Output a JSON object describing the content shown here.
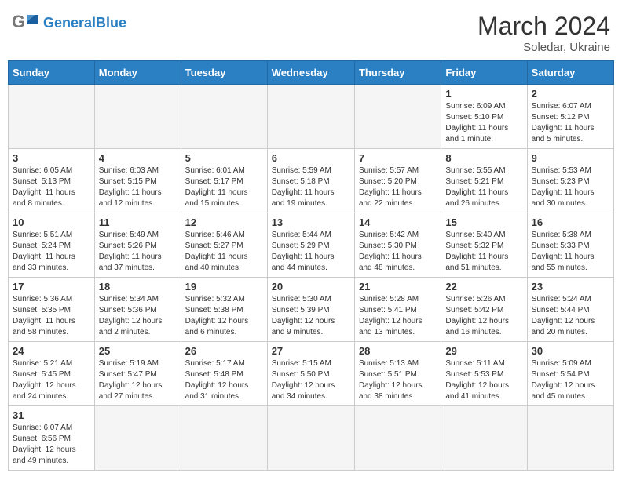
{
  "header": {
    "logo_general": "General",
    "logo_blue": "Blue",
    "month_year": "March 2024",
    "location": "Soledar, Ukraine"
  },
  "weekdays": [
    "Sunday",
    "Monday",
    "Tuesday",
    "Wednesday",
    "Thursday",
    "Friday",
    "Saturday"
  ],
  "weeks": [
    [
      {
        "day": "",
        "info": "",
        "empty": true
      },
      {
        "day": "",
        "info": "",
        "empty": true
      },
      {
        "day": "",
        "info": "",
        "empty": true
      },
      {
        "day": "",
        "info": "",
        "empty": true
      },
      {
        "day": "",
        "info": "",
        "empty": true
      },
      {
        "day": "1",
        "info": "Sunrise: 6:09 AM\nSunset: 5:10 PM\nDaylight: 11 hours\nand 1 minute."
      },
      {
        "day": "2",
        "info": "Sunrise: 6:07 AM\nSunset: 5:12 PM\nDaylight: 11 hours\nand 5 minutes."
      }
    ],
    [
      {
        "day": "3",
        "info": "Sunrise: 6:05 AM\nSunset: 5:13 PM\nDaylight: 11 hours\nand 8 minutes."
      },
      {
        "day": "4",
        "info": "Sunrise: 6:03 AM\nSunset: 5:15 PM\nDaylight: 11 hours\nand 12 minutes."
      },
      {
        "day": "5",
        "info": "Sunrise: 6:01 AM\nSunset: 5:17 PM\nDaylight: 11 hours\nand 15 minutes."
      },
      {
        "day": "6",
        "info": "Sunrise: 5:59 AM\nSunset: 5:18 PM\nDaylight: 11 hours\nand 19 minutes."
      },
      {
        "day": "7",
        "info": "Sunrise: 5:57 AM\nSunset: 5:20 PM\nDaylight: 11 hours\nand 22 minutes."
      },
      {
        "day": "8",
        "info": "Sunrise: 5:55 AM\nSunset: 5:21 PM\nDaylight: 11 hours\nand 26 minutes."
      },
      {
        "day": "9",
        "info": "Sunrise: 5:53 AM\nSunset: 5:23 PM\nDaylight: 11 hours\nand 30 minutes."
      }
    ],
    [
      {
        "day": "10",
        "info": "Sunrise: 5:51 AM\nSunset: 5:24 PM\nDaylight: 11 hours\nand 33 minutes."
      },
      {
        "day": "11",
        "info": "Sunrise: 5:49 AM\nSunset: 5:26 PM\nDaylight: 11 hours\nand 37 minutes."
      },
      {
        "day": "12",
        "info": "Sunrise: 5:46 AM\nSunset: 5:27 PM\nDaylight: 11 hours\nand 40 minutes."
      },
      {
        "day": "13",
        "info": "Sunrise: 5:44 AM\nSunset: 5:29 PM\nDaylight: 11 hours\nand 44 minutes."
      },
      {
        "day": "14",
        "info": "Sunrise: 5:42 AM\nSunset: 5:30 PM\nDaylight: 11 hours\nand 48 minutes."
      },
      {
        "day": "15",
        "info": "Sunrise: 5:40 AM\nSunset: 5:32 PM\nDaylight: 11 hours\nand 51 minutes."
      },
      {
        "day": "16",
        "info": "Sunrise: 5:38 AM\nSunset: 5:33 PM\nDaylight: 11 hours\nand 55 minutes."
      }
    ],
    [
      {
        "day": "17",
        "info": "Sunrise: 5:36 AM\nSunset: 5:35 PM\nDaylight: 11 hours\nand 58 minutes."
      },
      {
        "day": "18",
        "info": "Sunrise: 5:34 AM\nSunset: 5:36 PM\nDaylight: 12 hours\nand 2 minutes."
      },
      {
        "day": "19",
        "info": "Sunrise: 5:32 AM\nSunset: 5:38 PM\nDaylight: 12 hours\nand 6 minutes."
      },
      {
        "day": "20",
        "info": "Sunrise: 5:30 AM\nSunset: 5:39 PM\nDaylight: 12 hours\nand 9 minutes."
      },
      {
        "day": "21",
        "info": "Sunrise: 5:28 AM\nSunset: 5:41 PM\nDaylight: 12 hours\nand 13 minutes."
      },
      {
        "day": "22",
        "info": "Sunrise: 5:26 AM\nSunset: 5:42 PM\nDaylight: 12 hours\nand 16 minutes."
      },
      {
        "day": "23",
        "info": "Sunrise: 5:24 AM\nSunset: 5:44 PM\nDaylight: 12 hours\nand 20 minutes."
      }
    ],
    [
      {
        "day": "24",
        "info": "Sunrise: 5:21 AM\nSunset: 5:45 PM\nDaylight: 12 hours\nand 24 minutes."
      },
      {
        "day": "25",
        "info": "Sunrise: 5:19 AM\nSunset: 5:47 PM\nDaylight: 12 hours\nand 27 minutes."
      },
      {
        "day": "26",
        "info": "Sunrise: 5:17 AM\nSunset: 5:48 PM\nDaylight: 12 hours\nand 31 minutes."
      },
      {
        "day": "27",
        "info": "Sunrise: 5:15 AM\nSunset: 5:50 PM\nDaylight: 12 hours\nand 34 minutes."
      },
      {
        "day": "28",
        "info": "Sunrise: 5:13 AM\nSunset: 5:51 PM\nDaylight: 12 hours\nand 38 minutes."
      },
      {
        "day": "29",
        "info": "Sunrise: 5:11 AM\nSunset: 5:53 PM\nDaylight: 12 hours\nand 41 minutes."
      },
      {
        "day": "30",
        "info": "Sunrise: 5:09 AM\nSunset: 5:54 PM\nDaylight: 12 hours\nand 45 minutes."
      }
    ],
    [
      {
        "day": "31",
        "info": "Sunrise: 6:07 AM\nSunset: 6:56 PM\nDaylight: 12 hours\nand 49 minutes."
      },
      {
        "day": "",
        "info": "",
        "empty": true
      },
      {
        "day": "",
        "info": "",
        "empty": true
      },
      {
        "day": "",
        "info": "",
        "empty": true
      },
      {
        "day": "",
        "info": "",
        "empty": true
      },
      {
        "day": "",
        "info": "",
        "empty": true
      },
      {
        "day": "",
        "info": "",
        "empty": true
      }
    ]
  ]
}
